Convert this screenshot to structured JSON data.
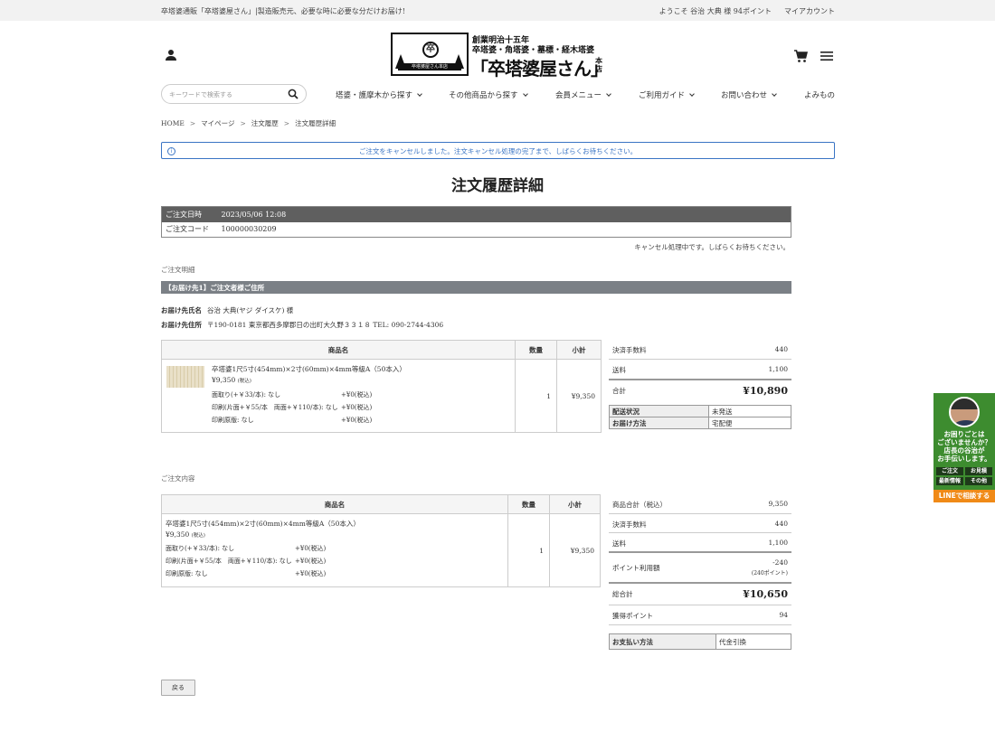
{
  "topbar": {
    "tagline": "卒塔婆通販「卒塔婆屋さん」|製造販売元、必要な時に必要な分だけお届け!",
    "welcome": "ようこそ 谷治 大典 様 94ポイント",
    "my_account": "マイアカウント"
  },
  "logo": {
    "tagline1": "創業明治十五年",
    "tagline2": "卒塔婆・角塔婆・墓標・経木塔婆",
    "name": "「卒塔婆屋さん」",
    "suffix": "本店",
    "seal_char": "卒",
    "seal_band": "卒塔婆屋さん本店"
  },
  "search": {
    "placeholder": "キーワードで検索する"
  },
  "nav": [
    "塔婆・護摩木から探す",
    "その他商品から探す",
    "会員メニュー",
    "ご利用ガイド",
    "お問い合わせ",
    "よみもの"
  ],
  "breadcrumb": [
    "HOME",
    "マイページ",
    "注文履歴",
    "注文履歴詳細"
  ],
  "notice": "ご注文をキャンセルしました。注文キャンセル処理の完了まで、しばらくお待ちください。",
  "page_title": "注文履歴詳細",
  "order": {
    "date_label": "ご注文日時",
    "date_value": "2023/05/06 12:08",
    "code_label": "ご注文コード",
    "code_value": "100000030209"
  },
  "cancel_message": "キャンセル処理中です。しばらくお待ちください。",
  "shipment": {
    "section_title": "ご注文明細",
    "bar_title": "【お届け先1】ご注文者様ご住所",
    "name_label": "お届け先氏名",
    "name_value": "谷治 大典(ヤジ ダイスケ) 様",
    "addr_label": "お届け先住所",
    "addr_value": "〒190-0181 東京都西多摩郡日の出町大久野３３１８ TEL: 090-2744-4306"
  },
  "table_headers": {
    "product": "商品名",
    "qty": "数量",
    "subtotal": "小計"
  },
  "product": {
    "name": "卒塔婆1尺5寸(454mm)×2寸(60mm)×4mm等級A（50本入）",
    "price": "¥9,350",
    "tax_note": "(税込)",
    "options": [
      {
        "label": "面取り(+￥33/本): なし",
        "value": "+¥0(税込)"
      },
      {
        "label": "印刷(片面+￥55/本　両面+￥110/本): なし",
        "value": "+¥0(税込)"
      },
      {
        "label": "印刷原版: なし",
        "value": "+¥0(税込)"
      }
    ],
    "qty": "1",
    "subtotal": "¥9,350"
  },
  "shipment_summary": {
    "fee_label": "決済手数料",
    "fee_value": "440",
    "shipping_label": "送料",
    "shipping_value": "1,100",
    "total_label": "合計",
    "total_value": "¥10,890",
    "status_label": "配送状況",
    "status_value": "未発送",
    "method_label": "お届け方法",
    "method_value": "宅配便"
  },
  "contents_section_title": "ご注文内容",
  "order_summary": {
    "items_label": "商品合計（税込）",
    "items_value": "9,350",
    "fee_label": "決済手数料",
    "fee_value": "440",
    "shipping_label": "送料",
    "shipping_value": "1,100",
    "points_used_label": "ポイント利用額",
    "points_used_value": "-240",
    "points_used_note": "(240ポイント)",
    "grand_label": "総合計",
    "grand_value": "¥10,650",
    "earned_label": "獲得ポイント",
    "earned_value": "94",
    "payment_label": "お支払い方法",
    "payment_value": "代金引換"
  },
  "back_button": "戻る",
  "widget": {
    "message": "お困りごとは\nございませんか？\n店長の谷治が\nお手伝いします。",
    "chips": [
      "ご注文",
      "お見積",
      "最新情報",
      "その他"
    ],
    "line_label": "LINEで相談する"
  }
}
